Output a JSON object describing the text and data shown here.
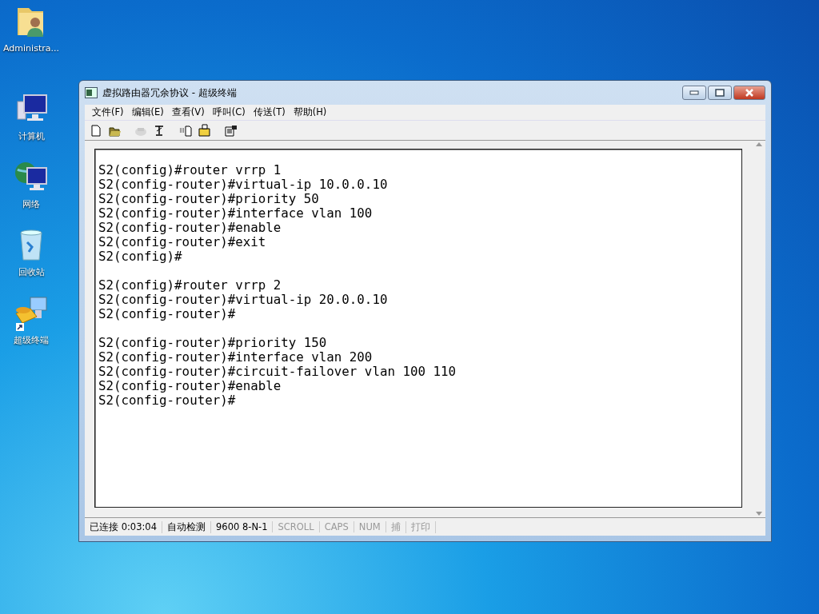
{
  "desktop_icons": [
    {
      "kind": "user-folder",
      "label": "Administra..."
    },
    {
      "kind": "computer",
      "label": "计算机"
    },
    {
      "kind": "network",
      "label": "网络"
    },
    {
      "kind": "recycle-bin",
      "label": "回收站"
    },
    {
      "kind": "terminal",
      "label": "超级终端"
    }
  ],
  "window": {
    "title": "虚拟路由器冗余协议 - 超级终端",
    "menu": [
      "文件(F)",
      "编辑(E)",
      "查看(V)",
      "呼叫(C)",
      "传送(T)",
      "帮助(H)"
    ],
    "toolbar": [
      {
        "kind": "new",
        "disabled": false
      },
      {
        "kind": "open",
        "disabled": false
      },
      {
        "kind": "call",
        "disabled": true
      },
      {
        "kind": "disconnect",
        "disabled": false
      },
      {
        "kind": "send",
        "disabled": false
      },
      {
        "kind": "receive",
        "disabled": false
      },
      {
        "kind": "properties",
        "disabled": false
      }
    ],
    "terminal_blocks": [
      [
        "S2(config)#router vrrp 1",
        "S2(config-router)#virtual-ip 10.0.0.10",
        "S2(config-router)#priority 50",
        "S2(config-router)#interface vlan 100",
        "S2(config-router)#enable",
        "S2(config-router)#exit",
        "S2(config)#"
      ],
      [
        "S2(config)#router vrrp 2",
        "S2(config-router)#virtual-ip 20.0.0.10",
        "S2(config-router)#"
      ],
      [
        "S2(config-router)#priority 150",
        "S2(config-router)#interface vlan 200",
        "S2(config-router)#circuit-failover vlan 100 110",
        "S2(config-router)#enable",
        "S2(config-router)#"
      ]
    ],
    "status_bar": [
      {
        "text": "已连接 0:03:04",
        "disabled": false
      },
      {
        "text": "自动检测",
        "disabled": false
      },
      {
        "text": "9600 8-N-1",
        "disabled": false
      },
      {
        "text": "SCROLL",
        "disabled": true
      },
      {
        "text": "CAPS",
        "disabled": true
      },
      {
        "text": "NUM",
        "disabled": true
      },
      {
        "text": "捕",
        "disabled": true
      },
      {
        "text": "打印",
        "disabled": true
      }
    ]
  }
}
